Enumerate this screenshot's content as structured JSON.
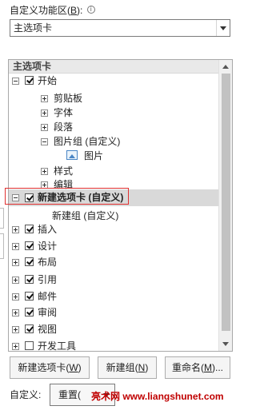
{
  "top": {
    "label_prefix": "自定义功能区(",
    "label_key": "B",
    "label_suffix": "):"
  },
  "combo": {
    "value": "主选项卡"
  },
  "tree": {
    "header": "主选项卡",
    "items": {
      "start": "开始",
      "clipboard": "剪贴板",
      "font": "字体",
      "paragraph": "段落",
      "picgroup": "图片组 (自定义)",
      "picture": "图片",
      "style": "样式",
      "edit": "编辑",
      "newtab": "新建选项卡 (自定义)",
      "newgroup": "新建组 (自定义)",
      "insert": "插入",
      "design": "设计",
      "layout": "布局",
      "reference": "引用",
      "mail": "邮件",
      "review": "审阅",
      "view": "视图",
      "dev": "开发工具"
    }
  },
  "buttons": {
    "newtab": {
      "prefix": "新建选项卡(",
      "key": "W",
      "suffix": ")"
    },
    "newgroup": {
      "prefix": "新建组(",
      "key": "N",
      "suffix": ")"
    },
    "rename": {
      "prefix": "重命名(",
      "key": "M",
      "suffix": ")..."
    }
  },
  "bottom": {
    "label": "自定义:",
    "reset": "重置(",
    "watermark": "亮术网 www.liangshunet.com"
  },
  "colors": {
    "highlight": "#e03030",
    "selected_row": "#d9d9d9"
  },
  "icons": [
    "info-icon",
    "chevron-down-icon",
    "expand-icon",
    "collapse-icon",
    "checkbox-icon",
    "picture-icon",
    "scroll-up-icon",
    "scroll-down-icon"
  ]
}
